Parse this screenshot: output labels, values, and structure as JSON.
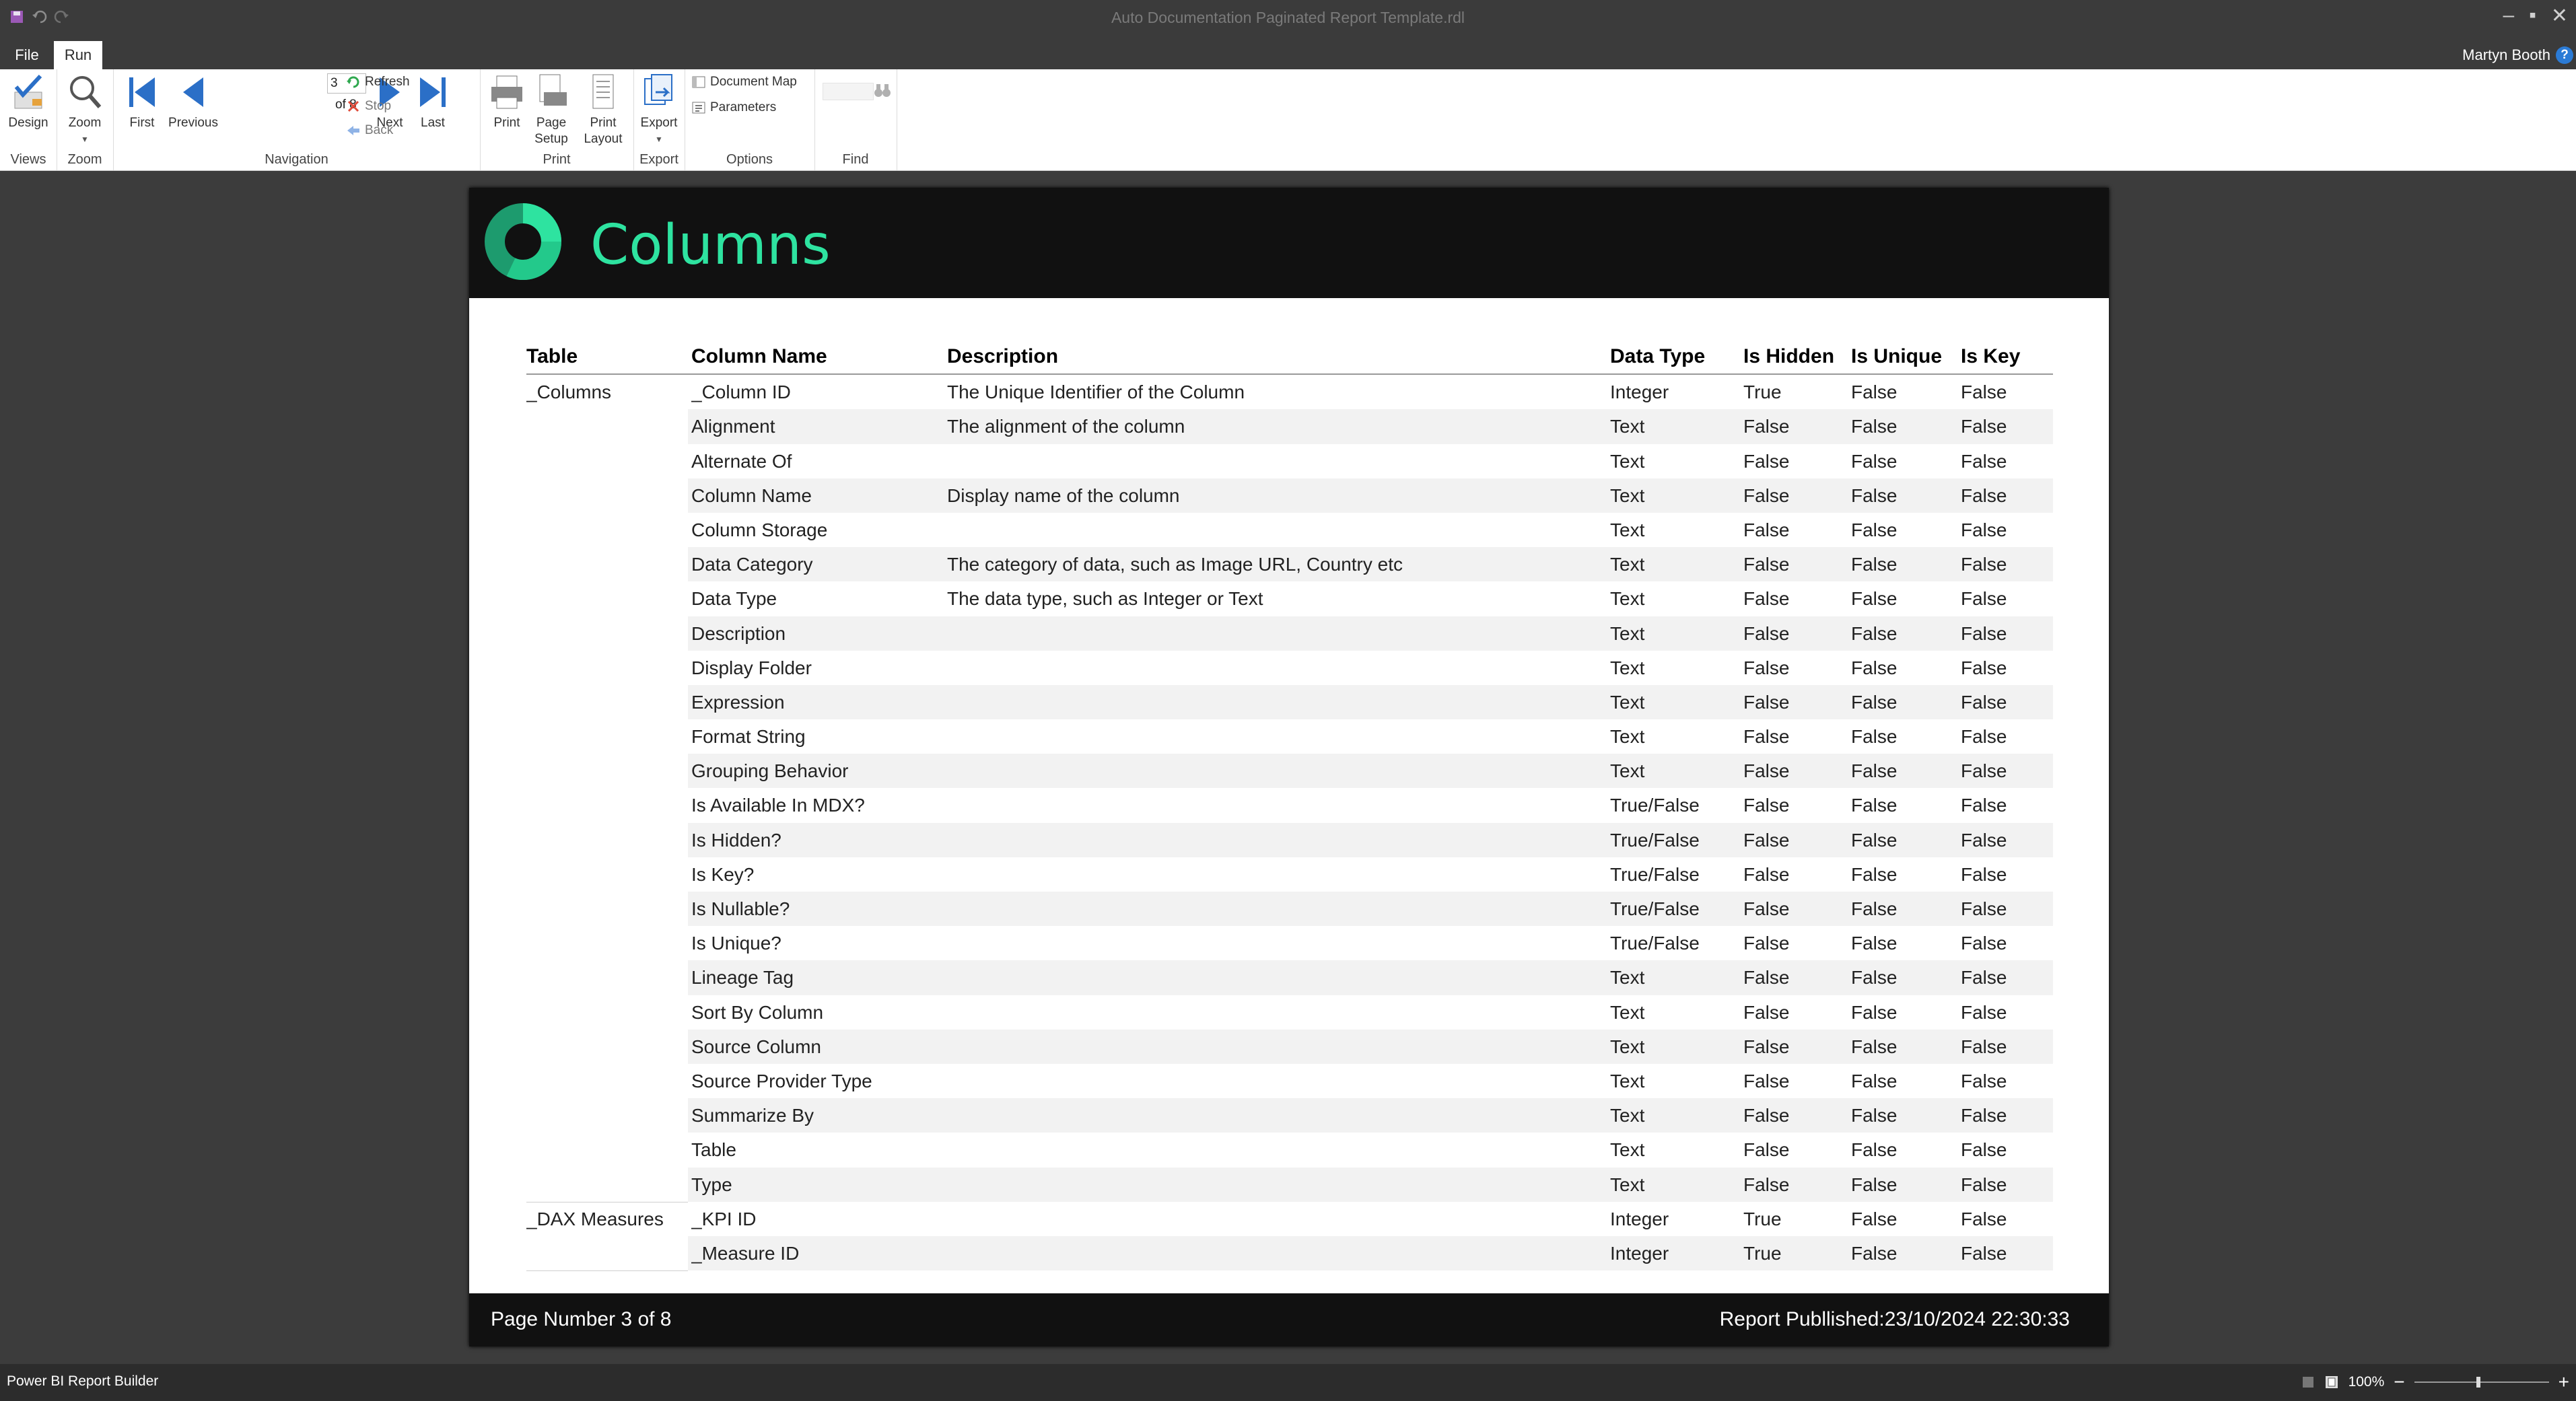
{
  "window": {
    "title": "Auto Documentation Paginated Report Template.rdl",
    "minimize_glyph": "–",
    "maximize_glyph": "▪",
    "close_glyph": "✕"
  },
  "ribbon_tabs": {
    "file": "File",
    "run": "Run",
    "user": "Martyn Booth",
    "help": "?"
  },
  "ribbon": {
    "views": {
      "group": "Views",
      "design": "Design"
    },
    "zoom": {
      "group": "Zoom",
      "zoom": "Zoom"
    },
    "navigation": {
      "group": "Navigation",
      "current_page": "3",
      "of_pages": "of 8",
      "first": "First",
      "previous": "Previous",
      "next": "Next",
      "last": "Last",
      "refresh": "Refresh",
      "stop": "Stop",
      "back": "Back"
    },
    "print": {
      "group": "Print",
      "print": "Print",
      "page_setup_1": "Page",
      "page_setup_2": "Setup",
      "print_layout_1": "Print",
      "print_layout_2": "Layout"
    },
    "export": {
      "group": "Export",
      "export": "Export"
    },
    "options": {
      "group": "Options",
      "document_map": "Document Map",
      "parameters": "Parameters"
    },
    "find": {
      "group": "Find"
    }
  },
  "report": {
    "title": "Columns",
    "colors": {
      "accent": "#2ee3a0",
      "header_bg": "#111111"
    },
    "headers": {
      "table": "Table",
      "column_name": "Column Name",
      "description": "Description",
      "data_type": "Data Type",
      "is_hidden": "Is Hidden",
      "is_unique": "Is Unique",
      "is_key": "Is Key"
    },
    "rows": [
      {
        "table": "_Columns",
        "column": "_Column ID",
        "desc": "The Unique Identifier of the Column",
        "dtype": "Integer",
        "hidden": "True",
        "unique": "False",
        "key": "False"
      },
      {
        "table": "",
        "column": "Alignment",
        "desc": "The alignment of the column",
        "dtype": "Text",
        "hidden": "False",
        "unique": "False",
        "key": "False"
      },
      {
        "table": "",
        "column": "Alternate Of",
        "desc": "",
        "dtype": "Text",
        "hidden": "False",
        "unique": "False",
        "key": "False"
      },
      {
        "table": "",
        "column": "Column Name",
        "desc": "Display name of the column",
        "dtype": "Text",
        "hidden": "False",
        "unique": "False",
        "key": "False"
      },
      {
        "table": "",
        "column": "Column Storage",
        "desc": "",
        "dtype": "Text",
        "hidden": "False",
        "unique": "False",
        "key": "False"
      },
      {
        "table": "",
        "column": "Data Category",
        "desc": "The category of data, such as Image URL, Country etc",
        "dtype": "Text",
        "hidden": "False",
        "unique": "False",
        "key": "False"
      },
      {
        "table": "",
        "column": "Data Type",
        "desc": "The data type, such as Integer or Text",
        "dtype": "Text",
        "hidden": "False",
        "unique": "False",
        "key": "False"
      },
      {
        "table": "",
        "column": "Description",
        "desc": "",
        "dtype": "Text",
        "hidden": "False",
        "unique": "False",
        "key": "False"
      },
      {
        "table": "",
        "column": "Display Folder",
        "desc": "",
        "dtype": "Text",
        "hidden": "False",
        "unique": "False",
        "key": "False"
      },
      {
        "table": "",
        "column": "Expression",
        "desc": "",
        "dtype": "Text",
        "hidden": "False",
        "unique": "False",
        "key": "False"
      },
      {
        "table": "",
        "column": "Format String",
        "desc": "",
        "dtype": "Text",
        "hidden": "False",
        "unique": "False",
        "key": "False"
      },
      {
        "table": "",
        "column": "Grouping Behavior",
        "desc": "",
        "dtype": "Text",
        "hidden": "False",
        "unique": "False",
        "key": "False"
      },
      {
        "table": "",
        "column": "Is Available In MDX?",
        "desc": "",
        "dtype": "True/False",
        "hidden": "False",
        "unique": "False",
        "key": "False"
      },
      {
        "table": "",
        "column": "Is Hidden?",
        "desc": "",
        "dtype": "True/False",
        "hidden": "False",
        "unique": "False",
        "key": "False"
      },
      {
        "table": "",
        "column": "Is Key?",
        "desc": "",
        "dtype": "True/False",
        "hidden": "False",
        "unique": "False",
        "key": "False"
      },
      {
        "table": "",
        "column": "Is Nullable?",
        "desc": "",
        "dtype": "True/False",
        "hidden": "False",
        "unique": "False",
        "key": "False"
      },
      {
        "table": "",
        "column": "Is Unique?",
        "desc": "",
        "dtype": "True/False",
        "hidden": "False",
        "unique": "False",
        "key": "False"
      },
      {
        "table": "",
        "column": "Lineage Tag",
        "desc": "",
        "dtype": "Text",
        "hidden": "False",
        "unique": "False",
        "key": "False"
      },
      {
        "table": "",
        "column": "Sort By Column",
        "desc": "",
        "dtype": "Text",
        "hidden": "False",
        "unique": "False",
        "key": "False"
      },
      {
        "table": "",
        "column": "Source Column",
        "desc": "",
        "dtype": "Text",
        "hidden": "False",
        "unique": "False",
        "key": "False"
      },
      {
        "table": "",
        "column": "Source Provider Type",
        "desc": "",
        "dtype": "Text",
        "hidden": "False",
        "unique": "False",
        "key": "False"
      },
      {
        "table": "",
        "column": "Summarize By",
        "desc": "",
        "dtype": "Text",
        "hidden": "False",
        "unique": "False",
        "key": "False"
      },
      {
        "table": "",
        "column": "Table",
        "desc": "",
        "dtype": "Text",
        "hidden": "False",
        "unique": "False",
        "key": "False"
      },
      {
        "table": "",
        "column": "Type",
        "desc": "",
        "dtype": "Text",
        "hidden": "False",
        "unique": "False",
        "key": "False"
      },
      {
        "table": "_DAX Measures",
        "column": "_KPI ID",
        "desc": "",
        "dtype": "Integer",
        "hidden": "True",
        "unique": "False",
        "key": "False"
      },
      {
        "table": "",
        "column": "_Measure ID",
        "desc": "",
        "dtype": "Integer",
        "hidden": "True",
        "unique": "False",
        "key": "False"
      }
    ],
    "footer_left": "Page Number 3 of 8",
    "footer_right": "Report Publlished:23/10/2024 22:30:33"
  },
  "statusbar": {
    "app": "Power BI Report Builder",
    "zoom": "100%",
    "zoom_out": "−",
    "zoom_in": "+"
  }
}
